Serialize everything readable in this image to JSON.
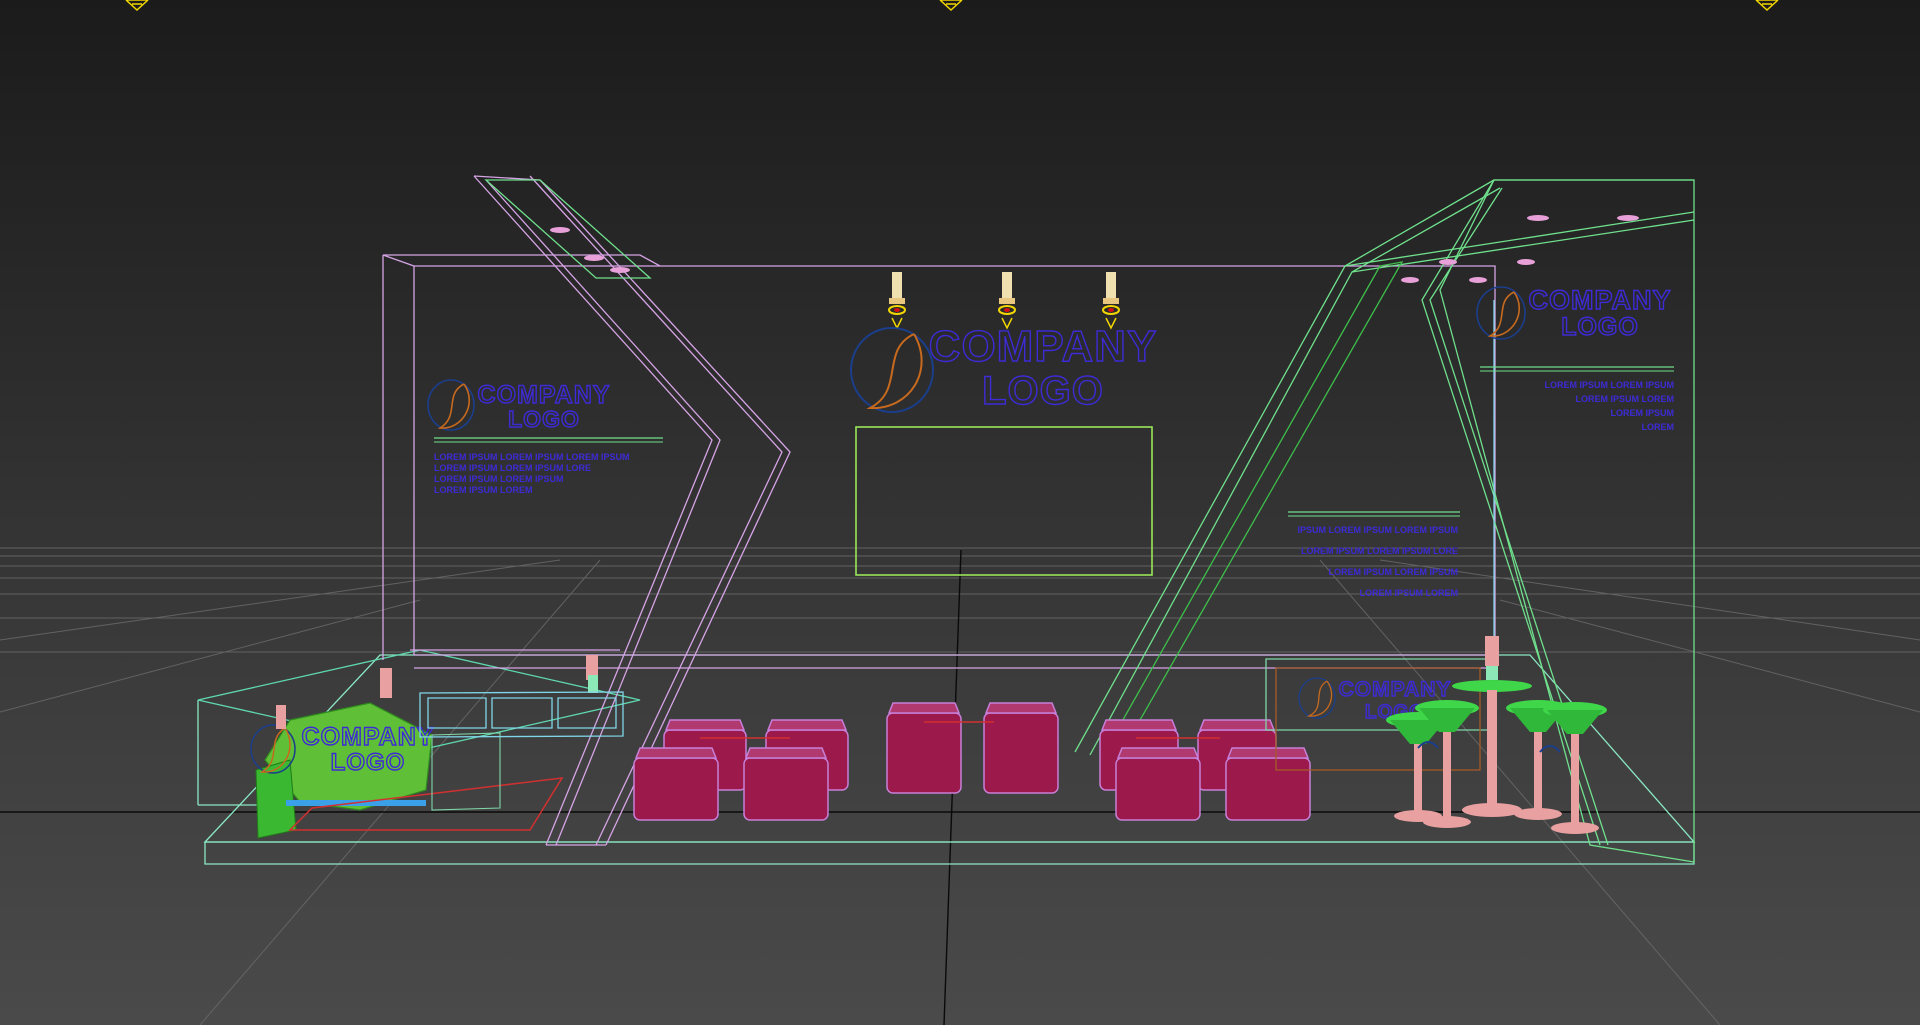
{
  "viewport": {
    "background": "#2b2b2b",
    "wire_colors": {
      "booth_frame": "#d6a4e6",
      "right_frame": "#6fe08c",
      "floor": "#8be8c4",
      "logo_text": "#3d2bd6",
      "chairs": "#9b1a4b",
      "stools": "#e8a0a0",
      "lights": "#f2d600",
      "screen": "#9be65a"
    }
  },
  "logos": {
    "center": {
      "line1": "COMPANY",
      "line2": "LOGO"
    },
    "left": {
      "line1": "COMPANY",
      "line2": "LOGO"
    },
    "right": {
      "line1": "COMPANY",
      "line2": "LOGO"
    },
    "counter": {
      "line1": "COMPANY",
      "line2": "LOGO"
    },
    "back_counter": {
      "line1": "COMPANY",
      "line2": "LOGO"
    }
  },
  "left_panel_text": [
    "LOREM IPSUM LOREM IPSUM LOREM IPSUM",
    "LOREM IPSUM LOREM IPSUM LORE",
    "LOREM IPSUM LOREM IPSUM",
    "LOREM IPSUM LOREM"
  ],
  "right_panel_text": [
    "LOREM IPSUM LOREM IPSUM",
    "LOREM IPSUM LOREM",
    "LOREM IPSUM",
    "LOREM"
  ],
  "middle_panel_text": [
    "IPSUM LOREM IPSUM LOREM IPSUM",
    "LOREM IPSUM LOREM IPSUM LORE",
    "LOREM IPSUM LOREM IPSUM",
    "LOREM IPSUM LOREM"
  ]
}
